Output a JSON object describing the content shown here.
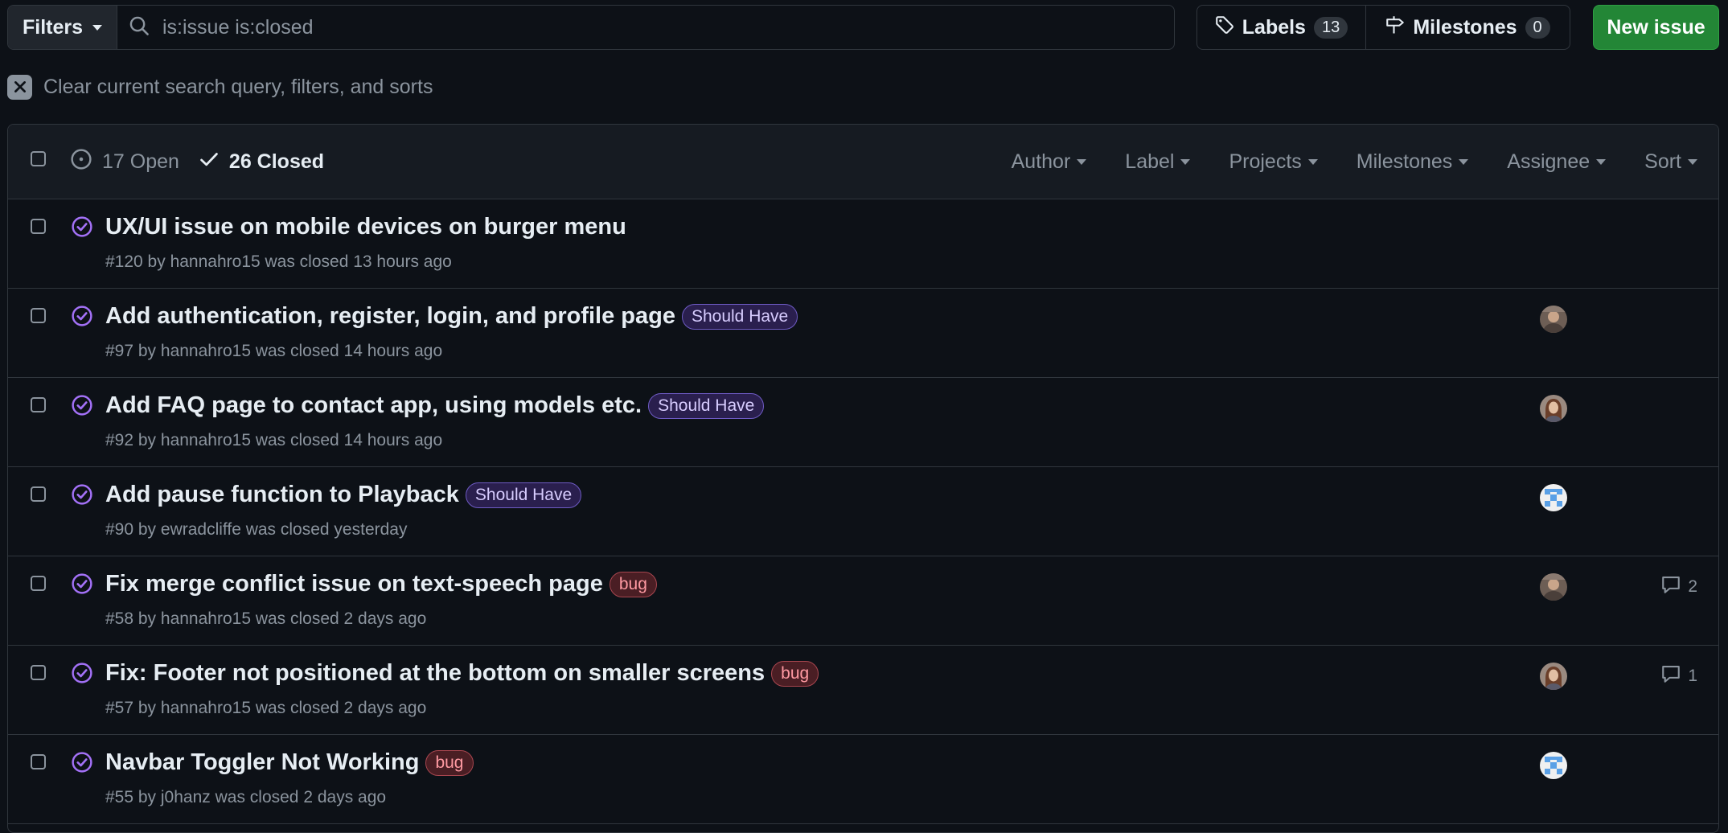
{
  "toolbar": {
    "filters_label": "Filters",
    "search_value": "is:issue is:closed",
    "labels_label": "Labels",
    "labels_count": "13",
    "milestones_label": "Milestones",
    "milestones_count": "0",
    "new_issue_label": "New issue"
  },
  "clear_filters": {
    "label": "Clear current search query, filters, and sorts"
  },
  "issues_header": {
    "open_label": "17 Open",
    "closed_label": "26 Closed",
    "menus": [
      "Author",
      "Label",
      "Projects",
      "Milestones",
      "Assignee",
      "Sort"
    ]
  },
  "issues": [
    {
      "title": "UX/UI issue on mobile devices on burger menu",
      "meta": "#120 by hannahro15 was closed 13 hours ago",
      "label": "",
      "label_kind": "",
      "avatar": "",
      "comments": ""
    },
    {
      "title": "Add authentication, register, login, and profile page",
      "meta": "#97 by hannahro15 was closed 14 hours ago",
      "label": "Should Have",
      "label_kind": "should",
      "avatar": "photo-a",
      "comments": ""
    },
    {
      "title": "Add FAQ page to contact app, using models etc.",
      "meta": "#92 by hannahro15 was closed 14 hours ago",
      "label": "Should Have",
      "label_kind": "should",
      "avatar": "photo-b",
      "comments": ""
    },
    {
      "title": "Add pause function to Playback",
      "meta": "#90 by ewradcliffe was closed yesterday",
      "label": "Should Have",
      "label_kind": "should",
      "avatar": "identicon",
      "comments": ""
    },
    {
      "title": "Fix merge conflict issue on text-speech page",
      "meta": "#58 by hannahro15 was closed 2 days ago",
      "label": "bug",
      "label_kind": "bug",
      "avatar": "photo-a",
      "comments": "2"
    },
    {
      "title": "Fix: Footer not positioned at the bottom on smaller screens",
      "meta": "#57 by hannahro15 was closed 2 days ago",
      "label": "bug",
      "label_kind": "bug",
      "avatar": "photo-b",
      "comments": "1"
    },
    {
      "title": "Navbar Toggler Not Working",
      "meta": "#55 by j0hanz was closed 2 days ago",
      "label": "bug",
      "label_kind": "bug",
      "avatar": "identicon",
      "comments": ""
    }
  ],
  "colors": {
    "background": "#0d1117",
    "header_bg": "#161b22",
    "border": "#30363d",
    "accent_closed": "#a371f7",
    "new_issue_green": "#238636"
  },
  "icons": {
    "search": "search-icon",
    "tag": "tag-icon",
    "milestone": "milestone-icon",
    "clear": "close-icon",
    "open_issue": "issue-open-icon",
    "check": "check-icon",
    "closed_issue": "issue-closed-icon",
    "comment": "comment-icon"
  }
}
